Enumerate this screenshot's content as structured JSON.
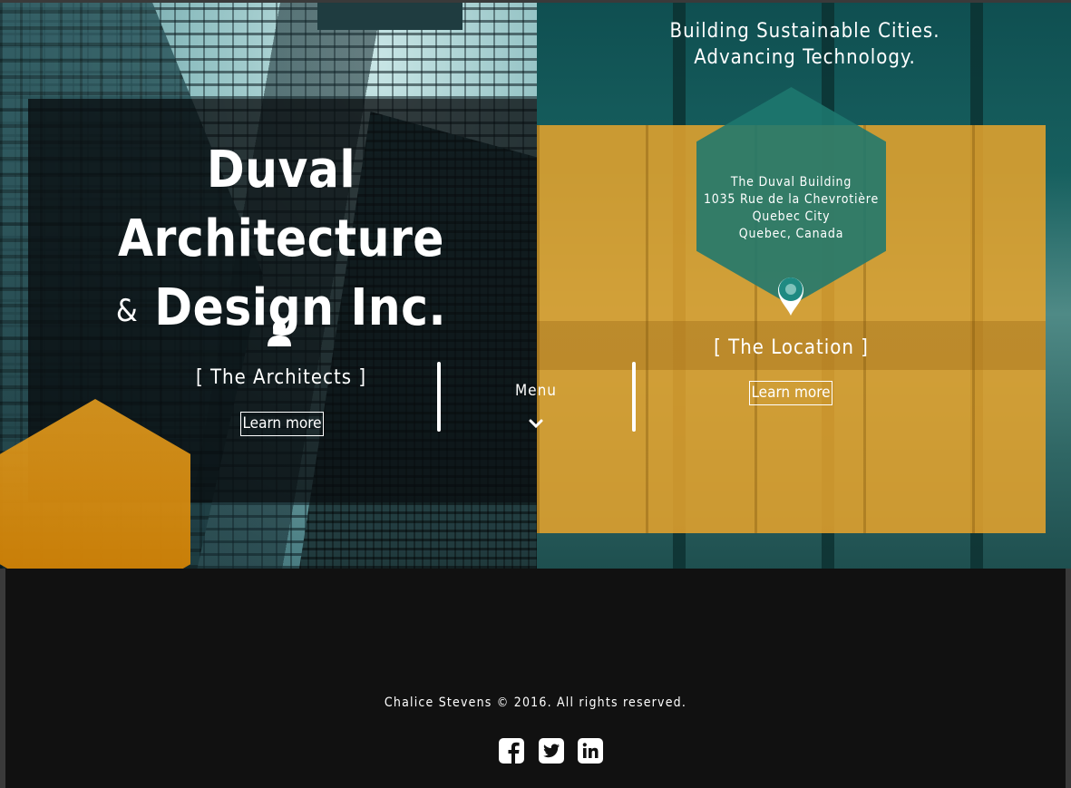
{
  "header": {
    "tagline_line1": "Building Sustainable Cities.",
    "tagline_line2": "Advancing Technology."
  },
  "brand": {
    "title_line1": "Duval Architecture",
    "title_amp": "&",
    "title_line2": "Design Inc."
  },
  "architects": {
    "icon": "user-icon",
    "label": "[ The Architects ]",
    "button_label": "Learn more"
  },
  "location": {
    "address_line1": "The Duval Building",
    "address_line2": "1035 Rue de la Chevrotière",
    "address_line3": "Quebec City",
    "address_line4": "Quebec, Canada",
    "icon": "map-pin-icon",
    "label": "[ The Location ]",
    "button_label": "Learn more"
  },
  "menu": {
    "label": "Menu",
    "icon": "chevron-down-icon"
  },
  "footer": {
    "copyright": "Chalice Stevens © 2016. All rights reserved.",
    "social": [
      "facebook-icon",
      "twitter-icon",
      "linkedin-icon"
    ]
  },
  "colors": {
    "accent_orange": "#E8A42C",
    "accent_teal": "#1E786E",
    "footer_bg": "#111111"
  }
}
